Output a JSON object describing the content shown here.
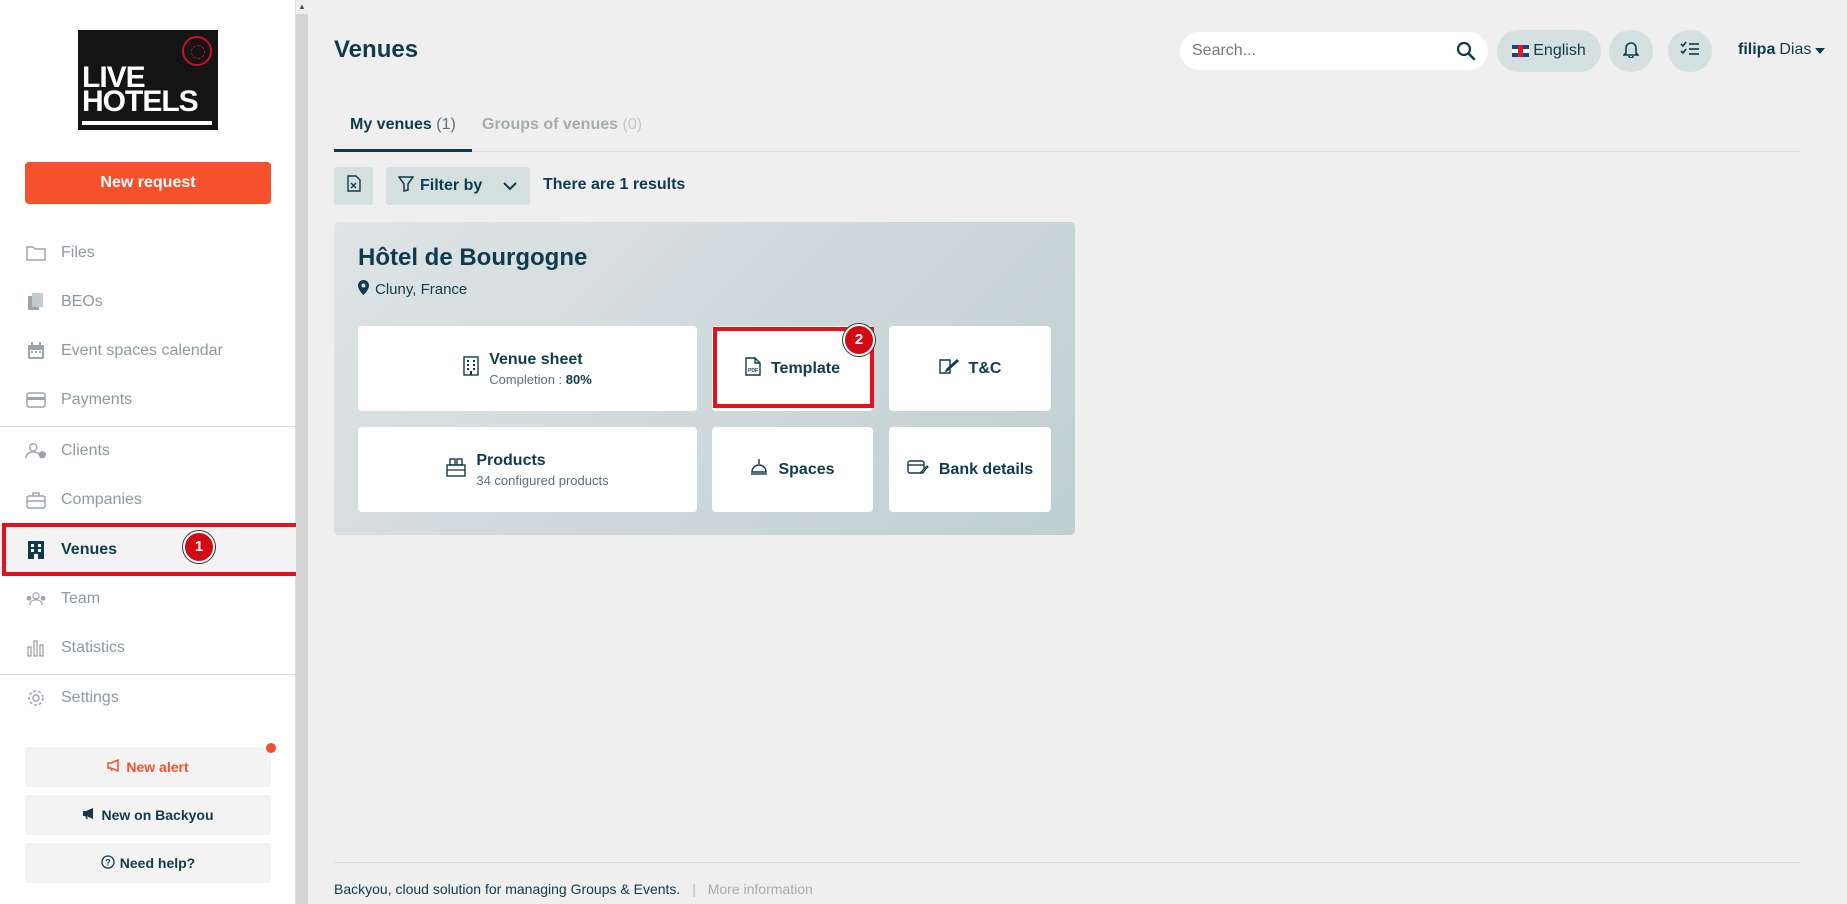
{
  "brand": {
    "logo_line1": "LIVE",
    "logo_line2": "HOTELS"
  },
  "sidebar": {
    "new_request": "New request",
    "items": [
      {
        "label": "Files",
        "icon": "folder-icon"
      },
      {
        "label": "BEOs",
        "icon": "documents-icon"
      },
      {
        "label": "Event spaces calendar",
        "icon": "calendar-icon"
      },
      {
        "label": "Payments",
        "icon": "credit-card-icon"
      },
      {
        "label": "Clients",
        "icon": "clients-icon"
      },
      {
        "label": "Companies",
        "icon": "briefcase-icon"
      },
      {
        "label": "Venues",
        "icon": "building-icon",
        "active": true
      },
      {
        "label": "Team",
        "icon": "team-icon"
      },
      {
        "label": "Statistics",
        "icon": "bar-chart-icon"
      },
      {
        "label": "Settings",
        "icon": "gear-icon"
      }
    ],
    "new_alert": "New alert",
    "new_on_backyou": "New on Backyou",
    "need_help": "Need help?"
  },
  "header": {
    "title": "Venues",
    "search_placeholder": "Search...",
    "language": "English",
    "user_first": "filipa",
    "user_last": "Dias"
  },
  "tabs": [
    {
      "label": "My venues",
      "count": "(1)",
      "active": true
    },
    {
      "label": "Groups of venues",
      "count": "(0)",
      "active": false
    }
  ],
  "toolbar": {
    "filter_label": "Filter by",
    "results_text": "There are 1 results"
  },
  "venue": {
    "name": "Hôtel de Bourgogne",
    "location": "Cluny, France",
    "venue_sheet": {
      "title": "Venue sheet",
      "sub_label": "Completion : ",
      "sub_value": "80%"
    },
    "template": "Template",
    "tc": "T&C",
    "products": {
      "title": "Products",
      "sub": "34 configured products"
    },
    "spaces": "Spaces",
    "bank_details": "Bank details"
  },
  "annotations": {
    "badge1": "1",
    "badge2": "2"
  },
  "footer": {
    "text": "Backyou, cloud solution for managing Groups & Events.",
    "separator": "|",
    "more": "More information"
  },
  "colors": {
    "primary": "#0f3b4c",
    "accent": "#f4512c",
    "annotation": "#e3111a"
  }
}
